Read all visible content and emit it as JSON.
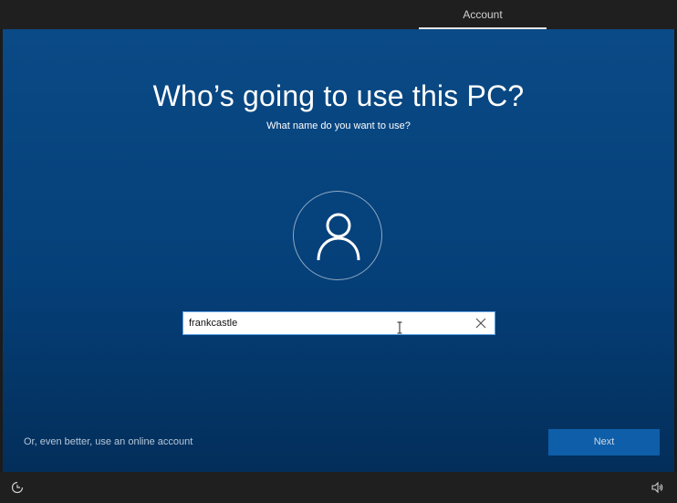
{
  "header": {
    "tab_label": "Account"
  },
  "main": {
    "title": "Who’s going to use this PC?",
    "subtitle": "What name do you want to use?",
    "name_input_value": "frankcastle",
    "online_account_link": "Or, even better, use an online account",
    "next_label": "Next"
  },
  "icons": {
    "avatar": "person-icon",
    "clear": "close-icon",
    "ease_of_access": "ease-of-access-icon",
    "volume": "volume-icon",
    "cursor": "text-cursor-icon"
  },
  "colors": {
    "background_blue": "#054079",
    "next_button": "#0e5ea9",
    "input_border": "#5aa0e6"
  }
}
